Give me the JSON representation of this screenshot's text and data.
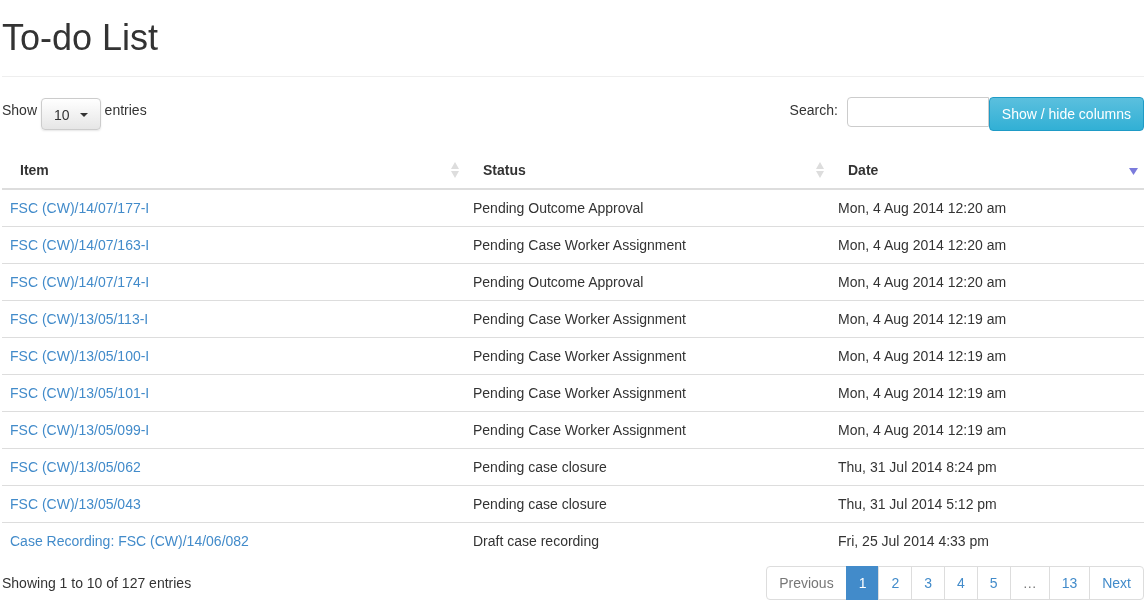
{
  "title": "To-do List",
  "length_control": {
    "label_before": "Show",
    "value": "10",
    "label_after": "entries"
  },
  "search": {
    "label": "Search:"
  },
  "columns_button": "Show / hide columns",
  "table": {
    "columns": [
      {
        "label": "Item",
        "sorted": false
      },
      {
        "label": "Status",
        "sorted": false
      },
      {
        "label": "Date",
        "sorted": true
      }
    ],
    "rows": [
      {
        "item": "FSC (CW)/14/07/177-I",
        "status": "Pending Outcome Approval",
        "date": "Mon, 4 Aug 2014 12:20 am"
      },
      {
        "item": "FSC (CW)/14/07/163-I",
        "status": "Pending Case Worker Assignment",
        "date": "Mon, 4 Aug 2014 12:20 am"
      },
      {
        "item": "FSC (CW)/14/07/174-I",
        "status": "Pending Outcome Approval",
        "date": "Mon, 4 Aug 2014 12:20 am"
      },
      {
        "item": "FSC (CW)/13/05/113-I",
        "status": "Pending Case Worker Assignment",
        "date": "Mon, 4 Aug 2014 12:19 am"
      },
      {
        "item": "FSC (CW)/13/05/100-I",
        "status": "Pending Case Worker Assignment",
        "date": "Mon, 4 Aug 2014 12:19 am"
      },
      {
        "item": "FSC (CW)/13/05/101-I",
        "status": "Pending Case Worker Assignment",
        "date": "Mon, 4 Aug 2014 12:19 am"
      },
      {
        "item": "FSC (CW)/13/05/099-I",
        "status": "Pending Case Worker Assignment",
        "date": "Mon, 4 Aug 2014 12:19 am"
      },
      {
        "item": "FSC (CW)/13/05/062",
        "status": "Pending case closure",
        "date": "Thu, 31 Jul 2014 8:24 pm"
      },
      {
        "item": "FSC (CW)/13/05/043",
        "status": "Pending case closure",
        "date": "Thu, 31 Jul 2014 5:12 pm"
      },
      {
        "item": "Case Recording: FSC (CW)/14/06/082",
        "status": "Draft case recording",
        "date": "Fri, 25 Jul 2014 4:33 pm"
      }
    ]
  },
  "info": "Showing 1 to 10 of 127 entries",
  "pagination": [
    {
      "label": "Previous",
      "selected": false,
      "disabled": true
    },
    {
      "label": "1",
      "selected": true,
      "disabled": false
    },
    {
      "label": "2",
      "selected": false,
      "disabled": false
    },
    {
      "label": "3",
      "selected": false,
      "disabled": false
    },
    {
      "label": "4",
      "selected": false,
      "disabled": false
    },
    {
      "label": "5",
      "selected": false,
      "disabled": false
    },
    {
      "label": "…",
      "selected": false,
      "disabled": true
    },
    {
      "label": "13",
      "selected": false,
      "disabled": false
    },
    {
      "label": "Next",
      "selected": false,
      "disabled": false
    }
  ]
}
